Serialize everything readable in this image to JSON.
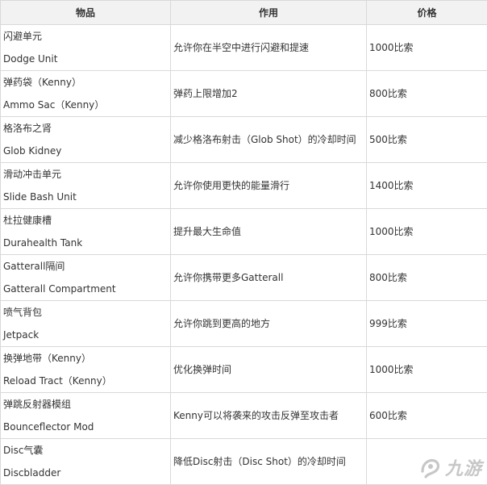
{
  "headers": {
    "item": "物品",
    "effect": "作用",
    "price": "价格"
  },
  "rows": [
    {
      "name_cn": "闪避单元",
      "name_en": "Dodge Unit",
      "effect": "允许你在半空中进行闪避和提速",
      "price": "1000比索"
    },
    {
      "name_cn": "弹药袋（Kenny）",
      "name_en": "Ammo Sac（Kenny）",
      "effect": "弹药上限增加2",
      "price": "800比索"
    },
    {
      "name_cn": "格洛布之肾",
      "name_en": "Glob Kidney",
      "effect": "减少格洛布射击（Glob Shot）的冷却时间",
      "price": "500比索"
    },
    {
      "name_cn": "滑动冲击单元",
      "name_en": "Slide Bash Unit",
      "effect": "允许你使用更快的能量滑行",
      "price": "1400比索"
    },
    {
      "name_cn": "杜拉健康槽",
      "name_en": "Durahealth Tank",
      "effect": "提升最大生命值",
      "price": "1000比索"
    },
    {
      "name_cn": "Gatterall隔间",
      "name_en": "Gatterall Compartment",
      "effect": "允许你携带更多Gatterall",
      "price": "800比索"
    },
    {
      "name_cn": "喷气背包",
      "name_en": "Jetpack",
      "effect": "允许你跳到更高的地方",
      "price": "999比索"
    },
    {
      "name_cn": "换弹地带（Kenny）",
      "name_en": "Reload Tract（Kenny）",
      "effect": "优化换弹时间",
      "price": "1000比索"
    },
    {
      "name_cn": "弹跳反射器模组",
      "name_en": "Bounceflector Mod",
      "effect": "Kenny可以将袭来的攻击反弹至攻击者",
      "price": "600比索"
    },
    {
      "name_cn": "Disc气囊",
      "name_en": "Discbladder",
      "effect": "降低Disc射击（Disc Shot）的冷却时间",
      "price": ""
    }
  ],
  "watermark": {
    "text": "九游",
    "icon": "jiuyou-logo-icon"
  }
}
